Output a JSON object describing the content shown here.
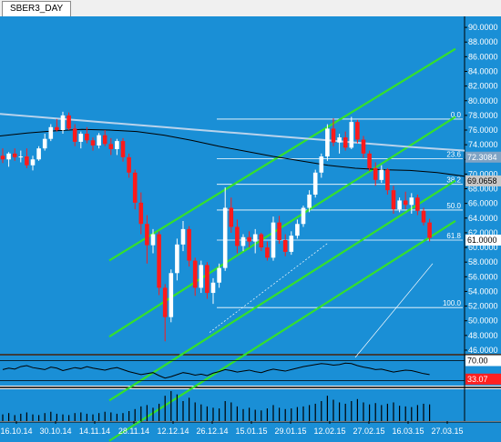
{
  "window": {
    "tab_label": "SBER3_DAY"
  },
  "colors": {
    "background": "#1a8fd6",
    "bull_candle": "#ffffff",
    "bear_candle": "#ff1a1a",
    "channel": "#34e02c",
    "ma_fast": "#000000",
    "ma_slow": "#b9d3ec",
    "fib": "#ffffff",
    "axis_text": "#ffffff",
    "price_marker_1": "#7fa3c4",
    "price_marker_2": "#c8c8c8",
    "price_marker_3": "#ffffff",
    "osc_marker_1": "#ffffff",
    "osc_marker_2": "#ff2020"
  },
  "chart_data": [
    {
      "type": "candlestick",
      "symbol": "SBER3",
      "timeframe": "DAY",
      "x_tick_labels": [
        "16.10.14",
        "30.10.14",
        "14.11.14",
        "28.11.14",
        "12.12.14",
        "26.12.14",
        "15.01.15",
        "29.01.15",
        "12.02.15",
        "27.02.15",
        "16.03.15",
        "27.03.15"
      ],
      "y_tick_labels": [
        "46.0000",
        "48.0000",
        "50.0000",
        "52.0000",
        "54.0000",
        "56.0000",
        "58.0000",
        "60.0000",
        "62.0000",
        "64.0000",
        "66.0000",
        "68.0000",
        "70.0000",
        "72.0000",
        "74.0000",
        "76.0000",
        "78.0000",
        "80.0000",
        "82.0000",
        "84.0000",
        "86.0000",
        "88.0000",
        "90.0000"
      ],
      "ylim": [
        45.5,
        91.5
      ],
      "price_markers": [
        "72.3084",
        "69.0658",
        "61.0000"
      ],
      "fib_levels": [
        {
          "label": "0.0",
          "value": 77.5
        },
        {
          "label": "23.6",
          "value": 72.1
        },
        {
          "label": "38.2",
          "value": 68.6
        },
        {
          "label": "50.0",
          "value": 65.1
        },
        {
          "label": "61.8",
          "value": 61.0
        },
        {
          "label": "100.0",
          "value": 51.8
        }
      ],
      "candles": [
        [
          72.5,
          73.5,
          71.5,
          72.0
        ],
        [
          72.0,
          73.0,
          71.0,
          72.8
        ],
        [
          72.8,
          73.5,
          71.8,
          72.3
        ],
        [
          72.3,
          73.2,
          71.6,
          72.4
        ],
        [
          72.4,
          73.5,
          70.8,
          71.2
        ],
        [
          71.2,
          72.5,
          70.5,
          72.0
        ],
        [
          72.0,
          73.8,
          71.8,
          73.5
        ],
        [
          73.5,
          75.5,
          73.2,
          74.8
        ],
        [
          74.8,
          76.8,
          74.5,
          76.4
        ],
        [
          76.4,
          77.5,
          75.8,
          76.0
        ],
        [
          76.0,
          78.5,
          75.5,
          78.0
        ],
        [
          78.0,
          78.4,
          76.0,
          76.2
        ],
        [
          76.2,
          76.8,
          73.8,
          74.4
        ],
        [
          74.4,
          75.8,
          73.5,
          75.5
        ],
        [
          75.5,
          76.4,
          74.2,
          74.6
        ],
        [
          74.6,
          75.0,
          73.2,
          73.9
        ],
        [
          73.9,
          75.6,
          73.5,
          75.3
        ],
        [
          75.3,
          76.0,
          73.8,
          74.1
        ],
        [
          74.1,
          74.9,
          72.6,
          73.4
        ],
        [
          73.4,
          74.8,
          72.6,
          74.5
        ],
        [
          74.5,
          74.9,
          71.7,
          72.3
        ],
        [
          72.3,
          72.8,
          69.5,
          70.2
        ],
        [
          70.2,
          70.6,
          65.2,
          66.1
        ],
        [
          66.1,
          67.5,
          61.8,
          63.2
        ],
        [
          63.2,
          64.4,
          57.8,
          60.3
        ],
        [
          60.3,
          62.5,
          59.2,
          61.8
        ],
        [
          61.8,
          62.2,
          53.5,
          54.5
        ],
        [
          54.5,
          55.0,
          47.2,
          50.5
        ],
        [
          50.5,
          57.0,
          49.8,
          56.5
        ],
        [
          56.5,
          61.2,
          55.5,
          60.4
        ],
        [
          60.4,
          63.6,
          59.5,
          62.5
        ],
        [
          62.5,
          62.9,
          57.4,
          58.2
        ],
        [
          58.2,
          58.6,
          53.4,
          54.5
        ],
        [
          54.5,
          58.2,
          53.8,
          57.6
        ],
        [
          57.6,
          58.0,
          53.0,
          53.8
        ],
        [
          53.8,
          55.8,
          52.3,
          55.2
        ],
        [
          55.2,
          57.8,
          54.5,
          57.2
        ],
        [
          57.2,
          68.2,
          56.8,
          65.4
        ],
        [
          65.4,
          66.8,
          62.0,
          62.8
        ],
        [
          62.8,
          63.8,
          59.2,
          60.2
        ],
        [
          60.2,
          61.8,
          59.5,
          61.4
        ],
        [
          61.4,
          62.2,
          60.0,
          60.8
        ],
        [
          60.8,
          62.5,
          59.2,
          61.8
        ],
        [
          61.8,
          62.0,
          59.5,
          60.0
        ],
        [
          60.0,
          60.8,
          58.2,
          58.6
        ],
        [
          58.6,
          64.2,
          58.2,
          63.4
        ],
        [
          63.4,
          64.3,
          60.5,
          61.0
        ],
        [
          61.0,
          61.8,
          58.8,
          59.4
        ],
        [
          59.4,
          62.2,
          59.0,
          61.6
        ],
        [
          61.6,
          63.8,
          61.2,
          63.2
        ],
        [
          63.2,
          65.7,
          62.8,
          65.4
        ],
        [
          65.4,
          67.8,
          64.8,
          67.2
        ],
        [
          67.2,
          70.6,
          66.8,
          70.2
        ],
        [
          70.2,
          72.8,
          69.5,
          72.4
        ],
        [
          72.4,
          76.8,
          71.8,
          76.2
        ],
        [
          76.2,
          77.6,
          73.8,
          74.3
        ],
        [
          74.3,
          75.5,
          72.8,
          75.0
        ],
        [
          75.0,
          75.8,
          73.2,
          73.6
        ],
        [
          73.6,
          77.8,
          73.4,
          77.1
        ],
        [
          77.1,
          77.4,
          74.2,
          74.7
        ],
        [
          74.7,
          75.2,
          72.2,
          72.8
        ],
        [
          72.8,
          73.2,
          70.4,
          70.8
        ],
        [
          70.8,
          71.6,
          68.4,
          69.2
        ],
        [
          69.2,
          71.2,
          68.8,
          70.6
        ],
        [
          70.6,
          70.8,
          67.2,
          67.8
        ],
        [
          67.8,
          68.4,
          64.6,
          65.2
        ],
        [
          65.2,
          66.8,
          64.8,
          66.4
        ],
        [
          66.4,
          67.6,
          65.2,
          65.8
        ],
        [
          65.8,
          67.4,
          64.6,
          66.8
        ],
        [
          66.8,
          67.2,
          64.4,
          65.0
        ],
        [
          65.0,
          65.4,
          63.0,
          63.4
        ],
        [
          63.4,
          63.9,
          60.8,
          61.3
        ]
      ],
      "moving_averages": [
        {
          "values": [
            78.2,
            77.9,
            77.6,
            77.3,
            77.0,
            76.7,
            76.4,
            76.1,
            75.8,
            75.5,
            75.2,
            74.9,
            74.6,
            74.3,
            74.0,
            73.7,
            73.45,
            73.2
          ]
        },
        {
          "values": [
            75.2,
            75.6,
            75.9,
            76.1,
            76.0,
            75.8,
            75.3,
            74.6,
            73.8,
            73.1,
            72.4,
            71.8,
            71.2,
            70.8,
            70.6,
            70.5,
            70.2,
            69.7
          ]
        }
      ],
      "channel_lines": [
        [
          60.5,
          81.0
        ],
        [
          50.2,
          71.5
        ],
        [
          41.5,
          62.8
        ],
        [
          36.0,
          57.3
        ]
      ],
      "trend_helper_lines": [
        [
          48.4,
          60.6
        ],
        [
          45.0,
          57.8
        ]
      ]
    },
    {
      "type": "line",
      "y_tick_labels": [
        "70.00",
        "33.07"
      ],
      "values": [
        52,
        55,
        53,
        58,
        60,
        56,
        54,
        52,
        57,
        55,
        50,
        53,
        56,
        54,
        58,
        55,
        53,
        51,
        54,
        56,
        52,
        48,
        45,
        42,
        44,
        46,
        40,
        35,
        38,
        42,
        46,
        44,
        41,
        43,
        40,
        45,
        48,
        52,
        50,
        47,
        49,
        51,
        48,
        46,
        50,
        53,
        51,
        49,
        52,
        55,
        58,
        60,
        62,
        64,
        63,
        61,
        62,
        65,
        64,
        60,
        57,
        55,
        52,
        53,
        50,
        47,
        49,
        51,
        50,
        47,
        44,
        42
      ]
    },
    {
      "type": "bar",
      "values": [
        10,
        12,
        9,
        11,
        13,
        10,
        9,
        12,
        14,
        11,
        10,
        9,
        12,
        13,
        11,
        10,
        12,
        14,
        13,
        11,
        12,
        15,
        18,
        22,
        24,
        20,
        26,
        38,
        45,
        40,
        30,
        35,
        28,
        25,
        22,
        20,
        19,
        30,
        28,
        22,
        18,
        20,
        17,
        16,
        19,
        24,
        20,
        18,
        19,
        21,
        22,
        24,
        26,
        30,
        38,
        32,
        28,
        26,
        30,
        33,
        28,
        25,
        27,
        24,
        26,
        28,
        23,
        22,
        21,
        24,
        26,
        25
      ]
    }
  ]
}
